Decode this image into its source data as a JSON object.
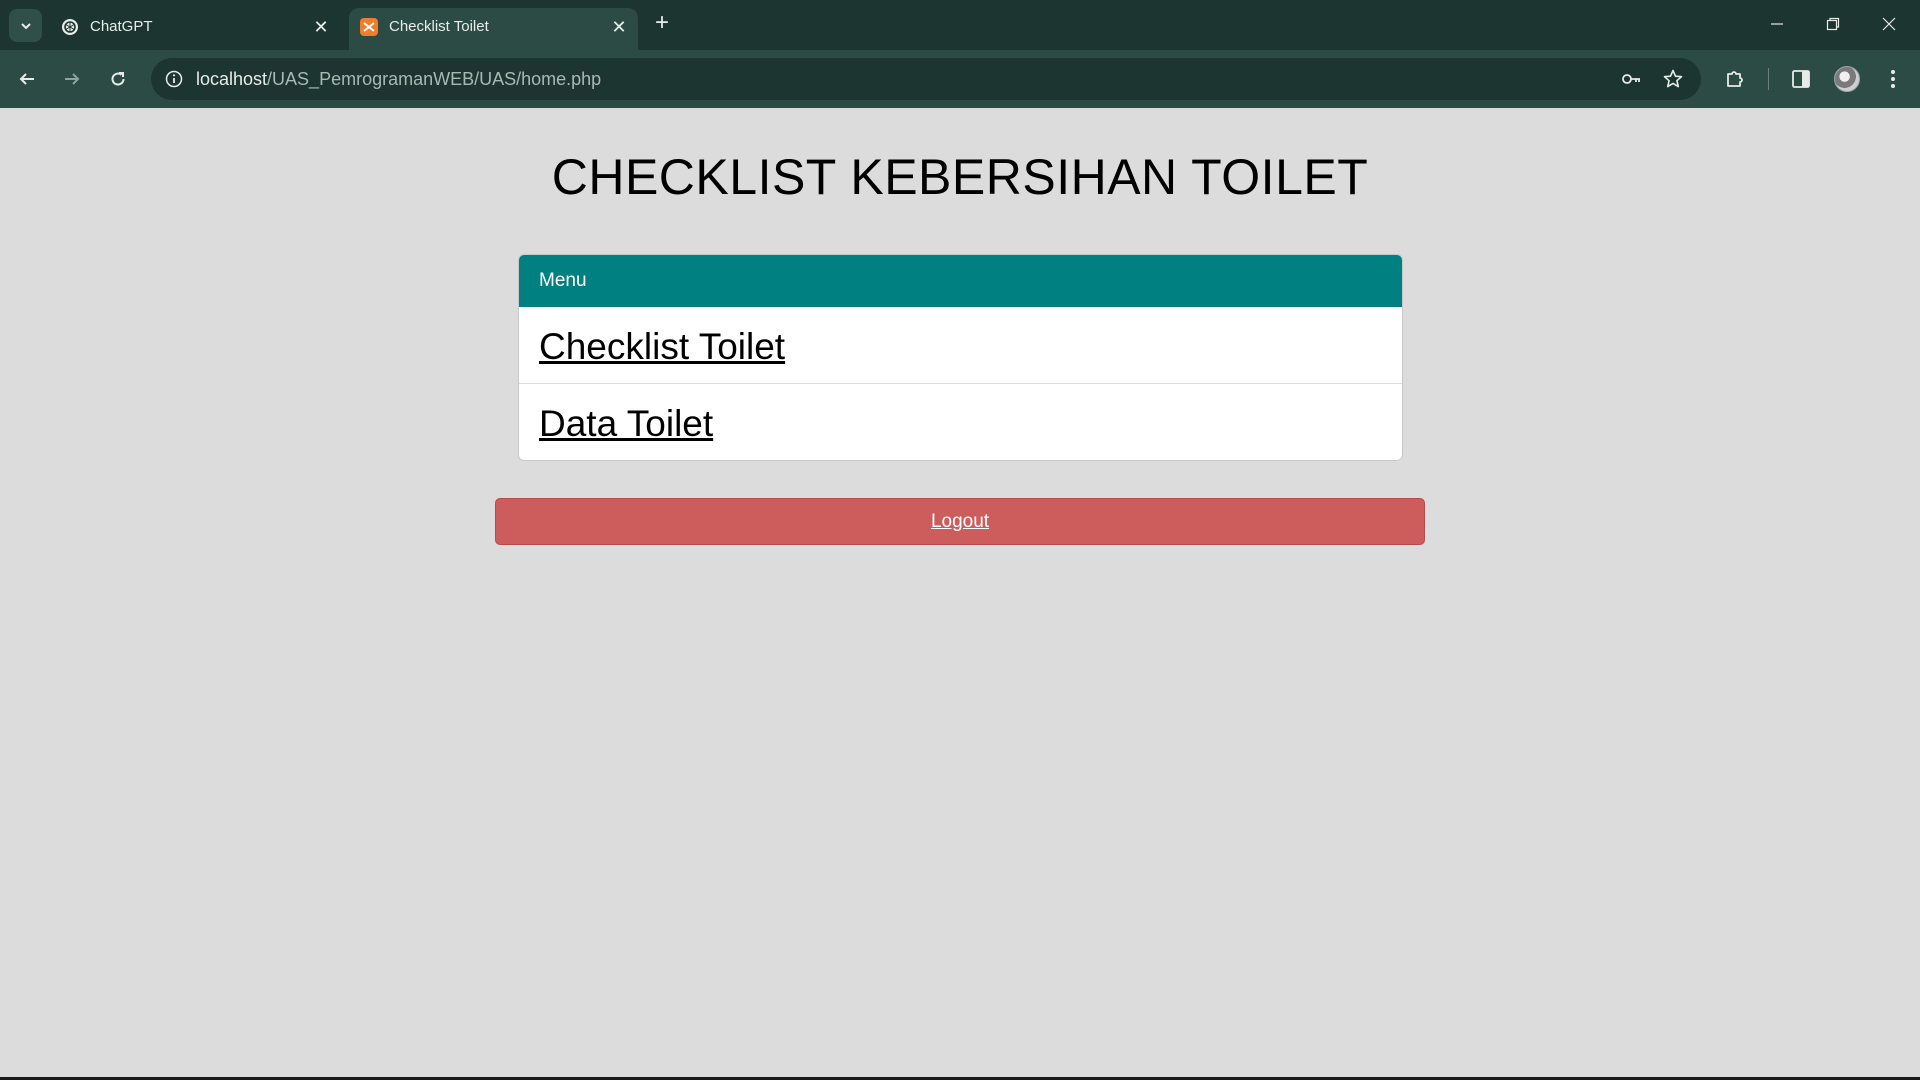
{
  "browser": {
    "tabs": [
      {
        "title": "ChatGPT",
        "icon": "chatgpt-favicon",
        "active": false
      },
      {
        "title": "Checklist Toilet",
        "icon": "xampp-favicon",
        "active": true
      }
    ],
    "url_host": "localhost",
    "url_path": "/UAS_PemrogramanWEB/UAS/home.php",
    "colors": {
      "tabbar": "#1d3530",
      "toolbar": "#2b4b44"
    }
  },
  "page": {
    "title": "CHECKLIST KEBERSIHAN TOILET",
    "background": "#dcdcdc",
    "menu": {
      "header": "Menu",
      "header_color": "#008080",
      "items": [
        "Checklist Toilet",
        "Data Toilet"
      ]
    },
    "logout": {
      "label": "Logout",
      "color": "#cd5c5c"
    }
  }
}
